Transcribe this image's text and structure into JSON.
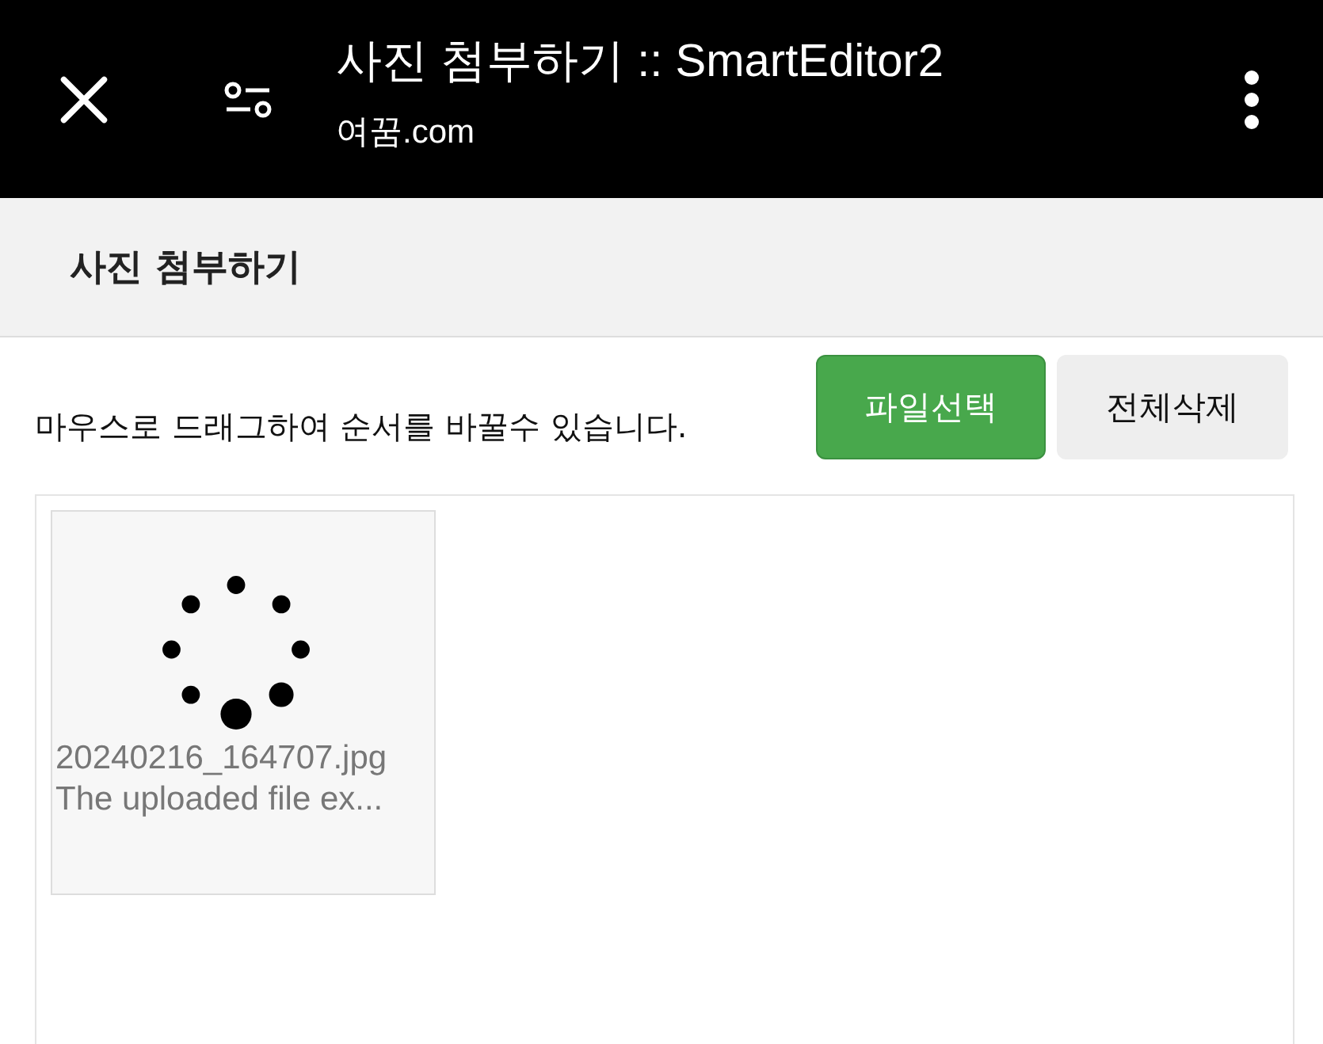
{
  "browser_bar": {
    "title": "사진 첨부하기 :: SmartEditor2",
    "domain": "여꿈.com"
  },
  "panel": {
    "title": "사진 첨부하기"
  },
  "hint": "마우스로 드래그하여 순서를 바꿀수 있습니다.",
  "buttons": [
    {
      "label": "파일선택",
      "kind": "primary"
    },
    {
      "label": "전체삭제",
      "kind": "default"
    }
  ],
  "files": [
    {
      "name": "20240216_164707.jpg",
      "message": "The uploaded file ex...",
      "loading": true
    }
  ]
}
